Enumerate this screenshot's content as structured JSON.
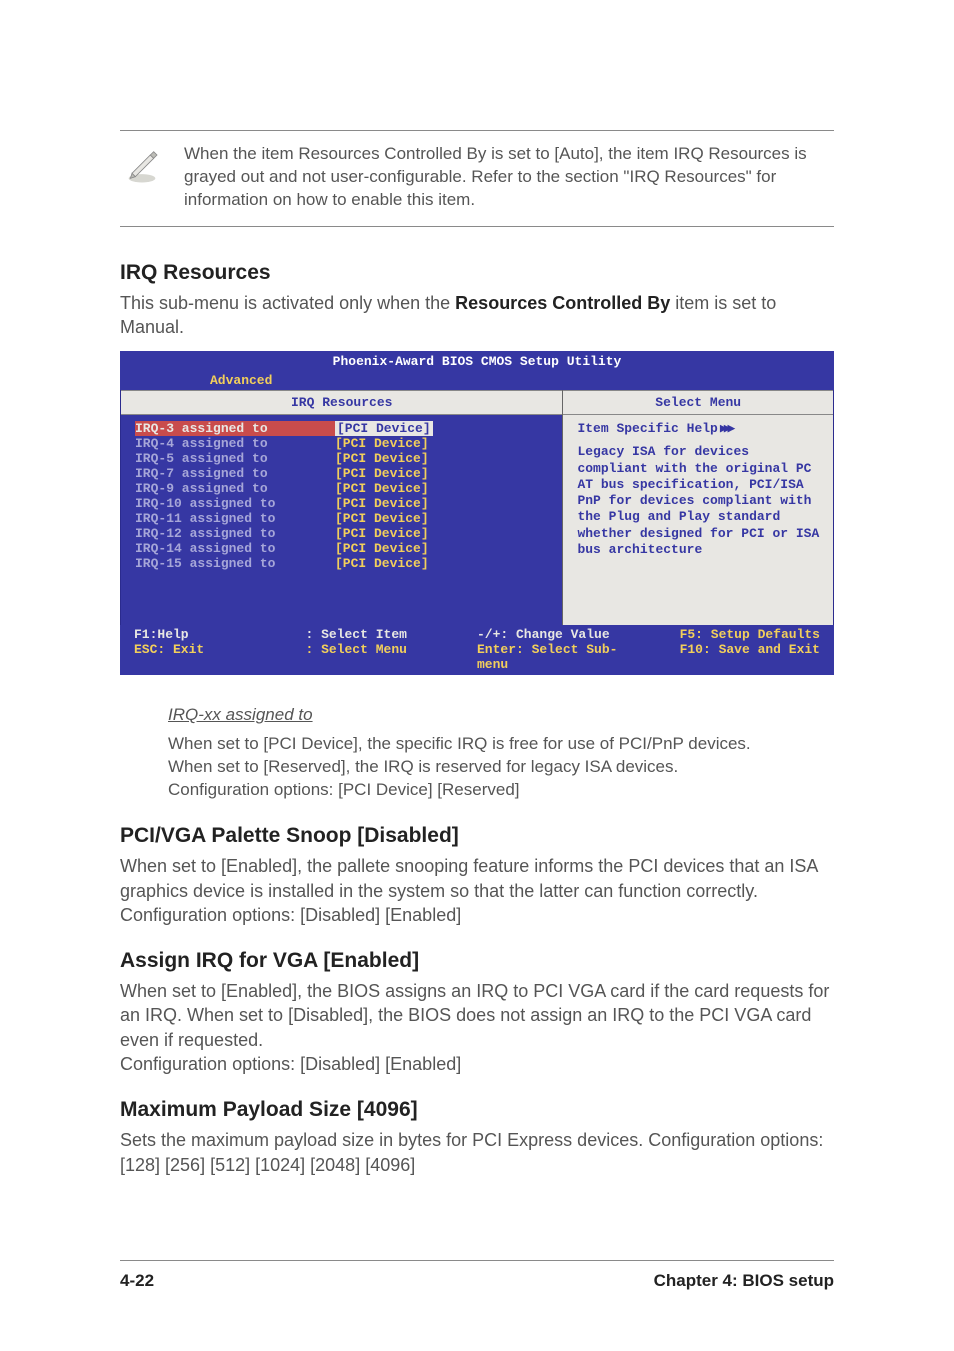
{
  "note": {
    "text": "When the item Resources Controlled By is set to [Auto], the item IRQ Resources is grayed out and not user-configurable. Refer to the section \"IRQ Resources\" for information on how to enable this item."
  },
  "section1": {
    "heading": "IRQ Resources",
    "intro_a": "This sub-menu is activated only when the ",
    "intro_bold": "Resources Controlled By",
    "intro_b": " item is set to Manual."
  },
  "bios": {
    "title": "Phoenix-Award BIOS CMOS Setup Utility",
    "tab": "Advanced",
    "left_header": "IRQ Resources",
    "right_header": "Select Menu",
    "rows": [
      {
        "label": "IRQ-3 assigned to",
        "value": "[PCI Device]",
        "selected": true
      },
      {
        "label": "IRQ-4 assigned to",
        "value": "[PCI Device]",
        "selected": false
      },
      {
        "label": "IRQ-5 assigned to",
        "value": "[PCI Device]",
        "selected": false
      },
      {
        "label": "IRQ-7 assigned to",
        "value": "[PCI Device]",
        "selected": false
      },
      {
        "label": "IRQ-9 assigned to",
        "value": "[PCI Device]",
        "selected": false
      },
      {
        "label": "IRQ-10 assigned to",
        "value": "[PCI Device]",
        "selected": false
      },
      {
        "label": "IRQ-11 assigned to",
        "value": "[PCI Device]",
        "selected": false
      },
      {
        "label": "IRQ-12 assigned to",
        "value": "[PCI Device]",
        "selected": false
      },
      {
        "label": "IRQ-14 assigned to",
        "value": "[PCI Device]",
        "selected": false
      },
      {
        "label": "IRQ-15 assigned to",
        "value": "[PCI Device]",
        "selected": false
      }
    ],
    "help_title": "Item Specific Help",
    "help_body": "Legacy ISA for devices compliant with the original PC AT bus specification, PCI/ISA PnP for devices compliant with the Plug and Play standard whether designed for PCI or ISA bus architecture",
    "footer": {
      "c1a": "F1:Help",
      "c1b": "ESC: Exit",
      "c2a": ": Select Item",
      "c2b": ": Select Menu",
      "c3a": "-/+: Change Value",
      "c3b": "Enter: Select Sub-menu",
      "c4a": "F5: Setup Defaults",
      "c4b": "F10: Save and Exit"
    }
  },
  "irq_item": {
    "heading": "IRQ-xx assigned to",
    "body": "When set to [PCI Device], the specific IRQ is free for use of PCI/PnP devices. When set to [Reserved], the IRQ is reserved for legacy ISA devices. Configuration options: [PCI Device] [Reserved]"
  },
  "pci_vga": {
    "heading": "PCI/VGA Palette Snoop [Disabled]",
    "body": "When set to [Enabled], the pallete snooping feature informs the PCI devices that an ISA graphics device is installed in the system so that the latter can function correctly. Configuration options: [Disabled] [Enabled]"
  },
  "assign_irq": {
    "heading": "Assign IRQ for VGA [Enabled]",
    "body": "When set to [Enabled], the BIOS assigns an IRQ to PCI VGA card if the card requests for an IRQ. When set to [Disabled], the BIOS does not assign an IRQ to the PCI VGA card even if requested.\nConfiguration options: [Disabled] [Enabled]"
  },
  "max_payload": {
    "heading": "Maximum Payload Size [4096]",
    "body": "Sets the maximum payload size in bytes for PCI Express devices. Configuration options: [128] [256] [512] [1024] [2048] [4096]"
  },
  "footer": {
    "left": "4-22",
    "right": "Chapter 4: BIOS setup"
  }
}
